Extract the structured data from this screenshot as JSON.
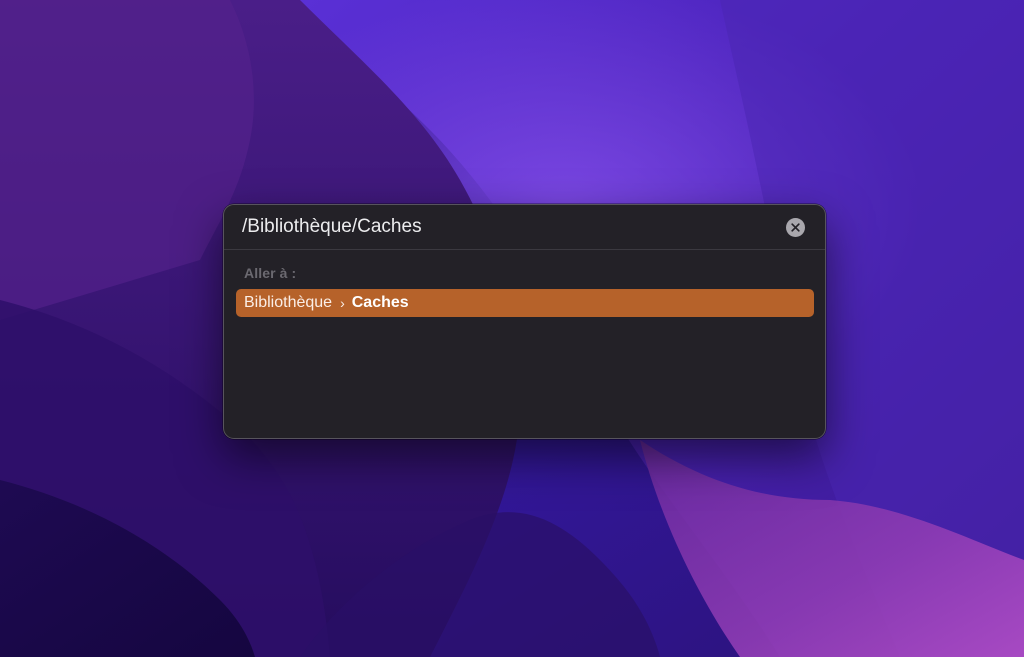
{
  "dialog": {
    "path_value": "/Bibliothèque/Caches",
    "clear_icon": "xmark-circle-fill",
    "section_label": "Aller à :",
    "suggestion": {
      "parent": "Bibliothèque",
      "separator": "›",
      "current": "Caches"
    }
  },
  "colors": {
    "highlight": "#b6622a",
    "panel": "#232127",
    "wallpaper_base": "#2a0d6e"
  }
}
